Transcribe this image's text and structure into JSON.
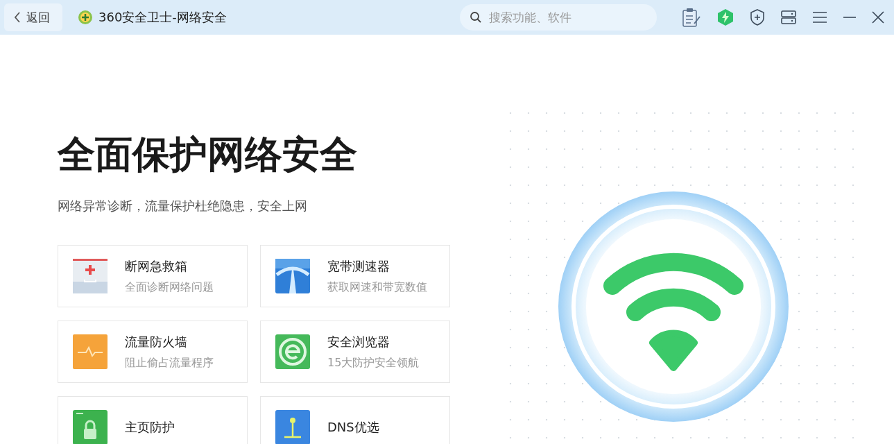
{
  "topbar": {
    "back": "返回",
    "title": "360安全卫士-网络安全",
    "search": {
      "placeholder": "搜索功能、软件"
    }
  },
  "hero": {
    "title": "全面保护网络安全",
    "subtitle": "网络异常诊断，流量保护杜绝隐患，安全上网"
  },
  "tools": [
    {
      "kind": "firstaid",
      "name": "断网急救箱",
      "desc": "全面诊断网络问题"
    },
    {
      "kind": "speed",
      "name": "宽带测速器",
      "desc": "获取网速和带宽数值"
    },
    {
      "kind": "firewall",
      "name": "流量防火墙",
      "desc": "阻止偷占流量程序"
    },
    {
      "kind": "browser",
      "name": "安全浏览器",
      "desc": "15大防护安全领航"
    },
    {
      "kind": "lock",
      "name": "主页防护"
    },
    {
      "kind": "dns",
      "name": "DNS优选"
    }
  ]
}
